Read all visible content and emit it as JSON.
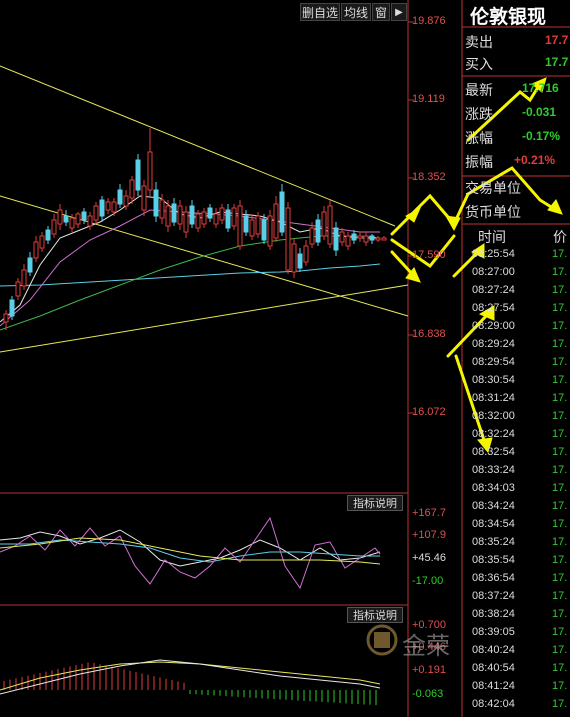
{
  "toolbar": {
    "delete_label": "删自选",
    "ma_label": "均线",
    "window_label": "窗",
    "arrow_label": "▶"
  },
  "price_axis": [
    "19.876",
    "19.119",
    "18.352",
    "17.590",
    "16.838",
    "16.072"
  ],
  "indicator1": {
    "title": "指标说明",
    "axis": [
      "+167.7",
      "+107.9",
      "+45.46",
      "-17.00"
    ]
  },
  "indicator2": {
    "title": "指标说明",
    "axis": [
      "+0.700",
      "+0.446",
      "+0.191",
      "-0.063"
    ]
  },
  "panel": {
    "title": "伦敦银现",
    "sell_label": "卖出",
    "sell_value": "17.7",
    "buy_label": "买入",
    "buy_value": "17.7",
    "latest_label": "最新",
    "latest_value": "17.716",
    "change_label": "涨跌",
    "change_value": "-0.031",
    "pct_label": "涨幅",
    "pct_value": "-0.17%",
    "amp_label": "振幅",
    "amp_value": "+0.21%",
    "trade_unit_label": "交易单位",
    "currency_unit_label": "货币单位",
    "col_time": "时间",
    "col_price": "价"
  },
  "ticks": [
    {
      "time": "08:25:54",
      "price": "17."
    },
    {
      "time": "08:27:00",
      "price": "17."
    },
    {
      "time": "08:27:24",
      "price": "17."
    },
    {
      "time": "08:27:54",
      "price": "17."
    },
    {
      "time": "08:29:00",
      "price": "17."
    },
    {
      "time": "08:29:24",
      "price": "17."
    },
    {
      "time": "08:29:54",
      "price": "17."
    },
    {
      "time": "08:30:54",
      "price": "17."
    },
    {
      "time": "08:31:24",
      "price": "17."
    },
    {
      "time": "08:32:00",
      "price": "17."
    },
    {
      "time": "08:32:24",
      "price": "17."
    },
    {
      "time": "08:32:54",
      "price": "17."
    },
    {
      "time": "08:33:24",
      "price": "17."
    },
    {
      "time": "08:34:03",
      "price": "17."
    },
    {
      "time": "08:34:24",
      "price": "17."
    },
    {
      "time": "08:34:54",
      "price": "17."
    },
    {
      "time": "08:35:24",
      "price": "17."
    },
    {
      "time": "08:35:54",
      "price": "17."
    },
    {
      "time": "08:36:54",
      "price": "17."
    },
    {
      "time": "08:37:24",
      "price": "17."
    },
    {
      "time": "08:38:24",
      "price": "17."
    },
    {
      "time": "08:39:05",
      "price": "17."
    },
    {
      "time": "08:40:24",
      "price": "17."
    },
    {
      "time": "08:40:54",
      "price": "17."
    },
    {
      "time": "08:41:24",
      "price": "17."
    },
    {
      "time": "08:42:04",
      "price": "17."
    }
  ],
  "watermark": "金荣"
}
